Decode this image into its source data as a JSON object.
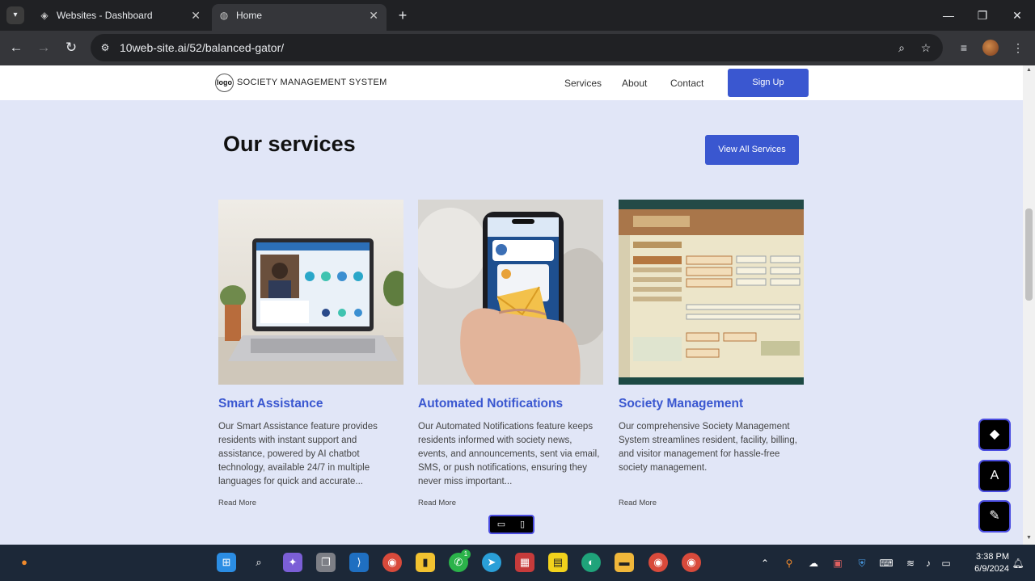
{
  "browser": {
    "tabs": [
      {
        "title": "Websites - Dashboard",
        "icon": "diamond-logo-icon"
      },
      {
        "title": "Home",
        "icon": "globe-icon"
      }
    ],
    "url": "10web-site.ai/52/balanced-gator/"
  },
  "site": {
    "logo_text": "logo",
    "brand": "SOCIETY MANAGEMENT SYSTEM",
    "nav": [
      "Services",
      "About",
      "Contact"
    ],
    "signup_label": "Sign Up"
  },
  "services": {
    "heading": "Our services",
    "view_all_label": "View All Services",
    "cards": [
      {
        "title": "Smart Assistance",
        "description": "Our Smart Assistance feature provides residents with instant support and assistance, powered by AI chatbot technology, available 24/7 in multiple languages for quick and accurate...",
        "read_more": "Read More"
      },
      {
        "title": "Automated Notifications",
        "description": "Our Automated Notifications feature keeps residents informed with society news, events, and announcements, sent via email, SMS, or push notifications, ensuring they never miss important...",
        "read_more": "Read More"
      },
      {
        "title": "Society Management",
        "description": "Our comprehensive Society Management System streamlines resident, facility, billing, and visitor management for hassle-free society management.",
        "read_more": "Read More"
      }
    ]
  },
  "colors": {
    "accent": "#3a57d0",
    "page_background": "#e1e6f7"
  },
  "taskbar": {
    "time": "3:38 PM",
    "date": "6/9/2024",
    "whatsapp_badge": "1"
  }
}
